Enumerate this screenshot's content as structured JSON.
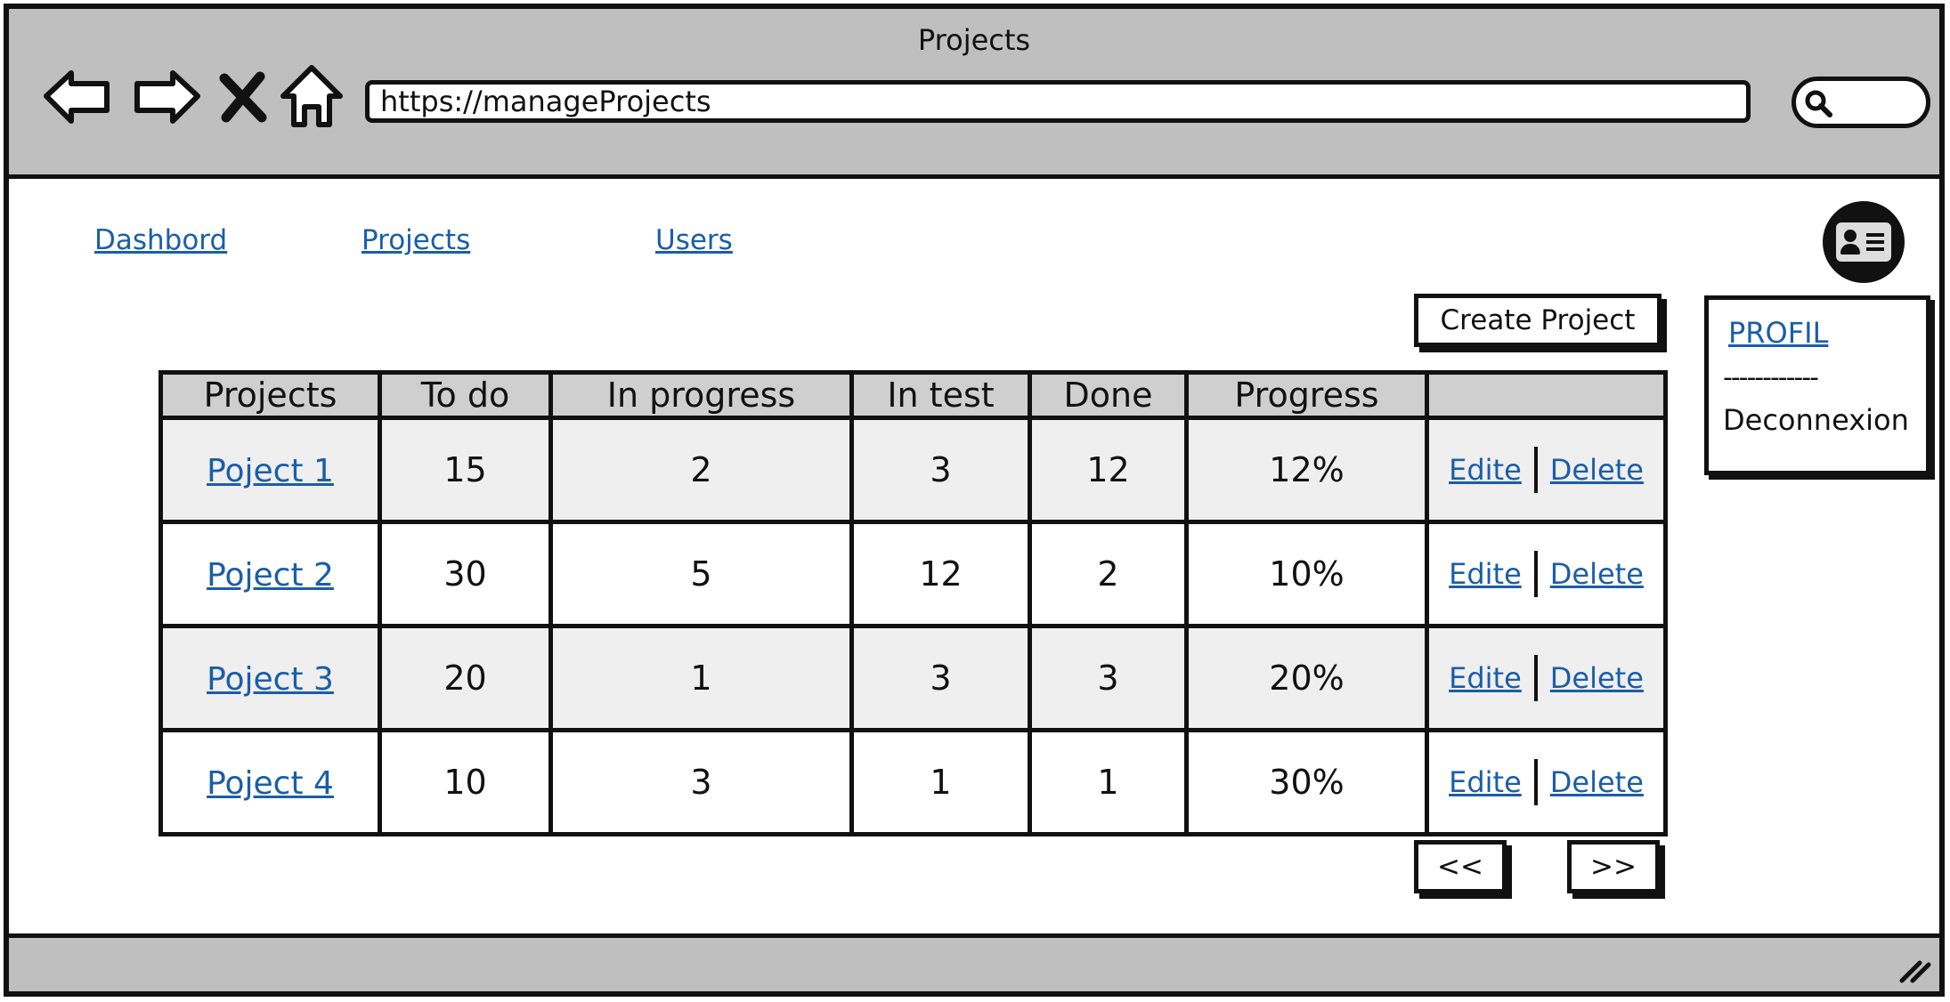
{
  "window": {
    "title": "Projects"
  },
  "browser": {
    "url": "https://manageProjects",
    "icons": [
      "back-arrow-icon",
      "forward-arrow-icon",
      "close-x-icon",
      "home-icon",
      "search-icon"
    ]
  },
  "nav": {
    "items": [
      {
        "label": "Dashbord"
      },
      {
        "label": "Projects"
      },
      {
        "label": "Users"
      }
    ]
  },
  "profile_menu": {
    "profile_label": "PROFIL",
    "separator": "------------",
    "logout_label": "Deconnexion"
  },
  "actions": {
    "create_label": "Create Project",
    "prev_label": "<<",
    "next_label": ">>"
  },
  "table": {
    "columns": [
      "Projects",
      "To do",
      "In progress",
      "In test",
      "Done",
      "Progress",
      ""
    ],
    "edit_label": "Edite",
    "delete_label": "Delete",
    "rows": [
      {
        "name": "Poject 1",
        "todo": "15",
        "in_progress": "2",
        "in_test": "3",
        "done": "12",
        "progress": "12%"
      },
      {
        "name": "Poject 2",
        "todo": "30",
        "in_progress": "5",
        "in_test": "12",
        "done": "2",
        "progress": "10%"
      },
      {
        "name": "Poject 3",
        "todo": "20",
        "in_progress": "1",
        "in_test": "3",
        "done": "3",
        "progress": "20%"
      },
      {
        "name": "Poject 4",
        "todo": "10",
        "in_progress": "3",
        "in_test": "1",
        "done": "1",
        "progress": "30%"
      }
    ]
  },
  "colors": {
    "link": "#1a5ea8",
    "chrome": "#bfbfbf",
    "header_row": "#cfcfcf",
    "shaded_row": "#efefef"
  }
}
